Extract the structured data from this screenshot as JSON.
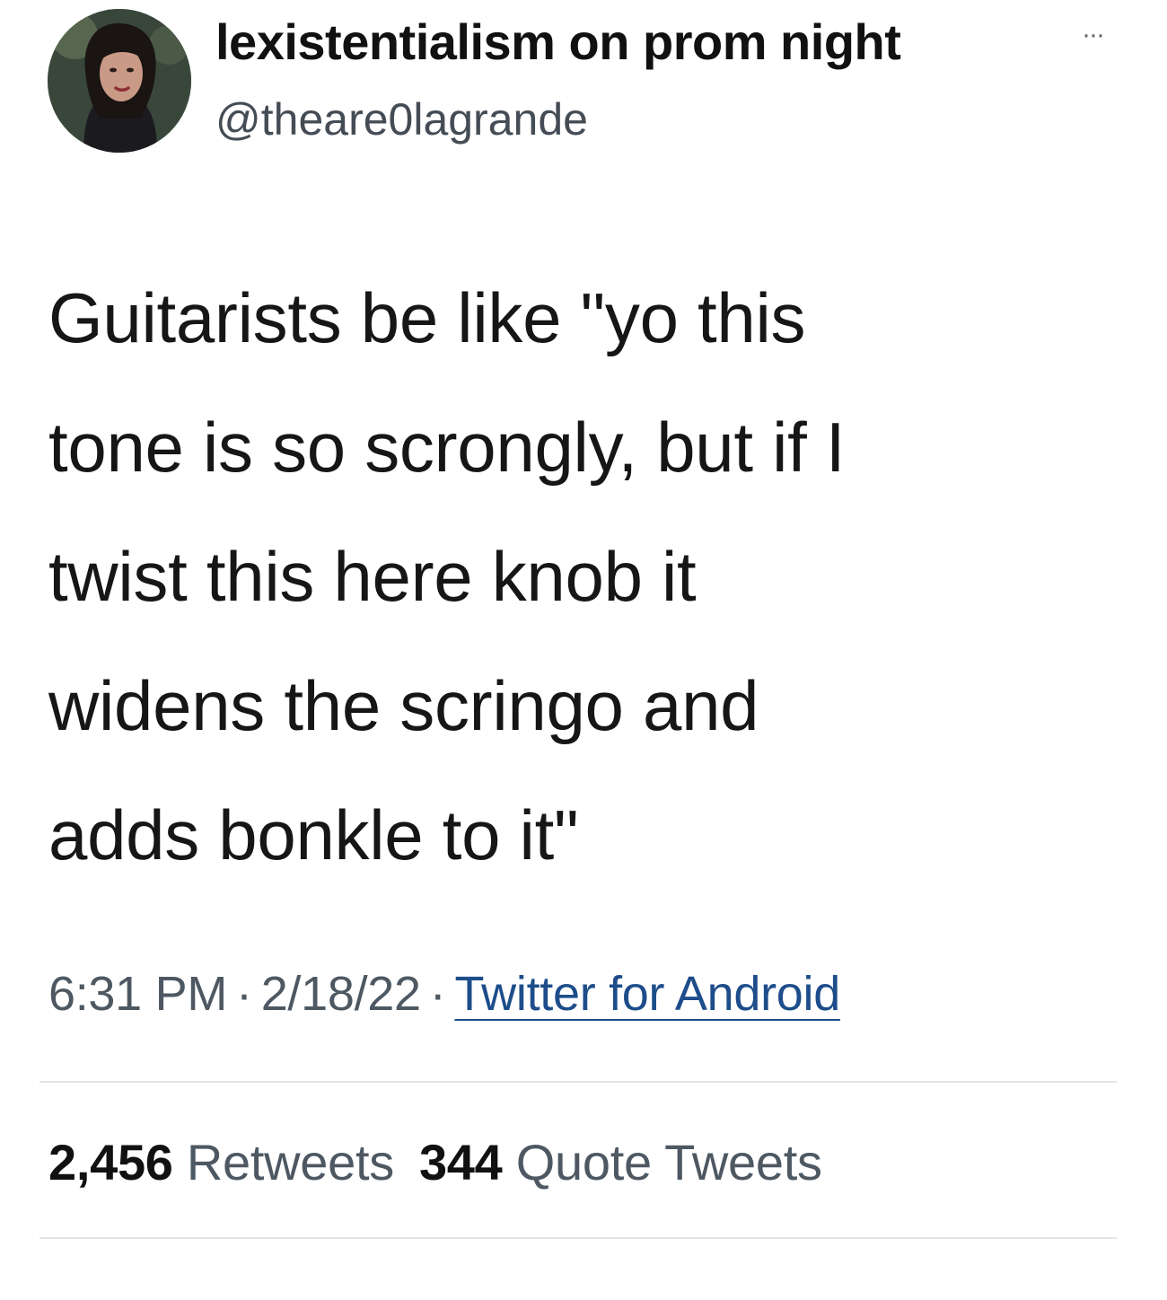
{
  "user": {
    "display_name": "lexistentialism on prom night",
    "handle": "@theare0lagrande",
    "more_icon": "more-horizontal-icon",
    "more_glyph": "···"
  },
  "tweet": {
    "text": "Guitarists be like \"yo this\ntone is so scrongly, but if I\ntwist this here knob it\nwidens the scringo and\nadds bonkle to it\""
  },
  "meta": {
    "time": "6:31 PM",
    "separator": "·",
    "date": "2/18/22",
    "source": "Twitter for Android"
  },
  "stats": {
    "retweets_count": "2,456",
    "retweets_label": "Retweets",
    "quotes_count": "344",
    "quotes_label": "Quote Tweets"
  },
  "colors": {
    "link": "#1d4d8a",
    "text": "#111111",
    "muted": "#4d5862",
    "divider": "#e3e5e8"
  }
}
